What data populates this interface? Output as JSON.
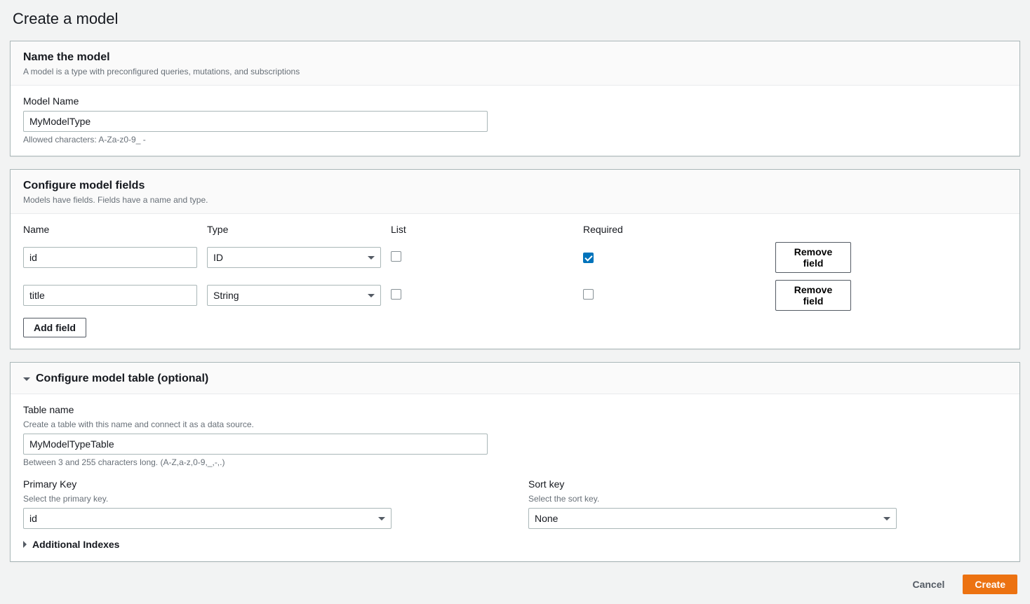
{
  "page": {
    "title": "Create a model"
  },
  "section_name": {
    "title": "Name the model",
    "desc": "A model is a type with preconfigured queries, mutations, and subscriptions",
    "field_label": "Model Name",
    "value": "MyModelType",
    "help": "Allowed characters: A-Za-z0-9_ -"
  },
  "section_fields": {
    "title": "Configure model fields",
    "desc": "Models have fields. Fields have a name and type.",
    "columns": {
      "name": "Name",
      "type": "Type",
      "list": "List",
      "required": "Required"
    },
    "rows": [
      {
        "name": "id",
        "type": "ID",
        "list": false,
        "required": true
      },
      {
        "name": "title",
        "type": "String",
        "list": false,
        "required": false
      }
    ],
    "remove_label": "Remove field",
    "add_label": "Add field"
  },
  "section_table": {
    "title": "Configure model table (optional)",
    "table_name_label": "Table name",
    "table_name_desc": "Create a table with this name and connect it as a data source.",
    "table_name_value": "MyModelTypeTable",
    "table_name_help": "Between 3 and 255 characters long. (A-Z,a-z,0-9,_,-,.)",
    "primary_key_label": "Primary Key",
    "primary_key_desc": "Select the primary key.",
    "primary_key_value": "id",
    "sort_key_label": "Sort key",
    "sort_key_desc": "Select the sort key.",
    "sort_key_value": "None",
    "additional_indexes_label": "Additional Indexes"
  },
  "footer": {
    "cancel": "Cancel",
    "create": "Create"
  }
}
